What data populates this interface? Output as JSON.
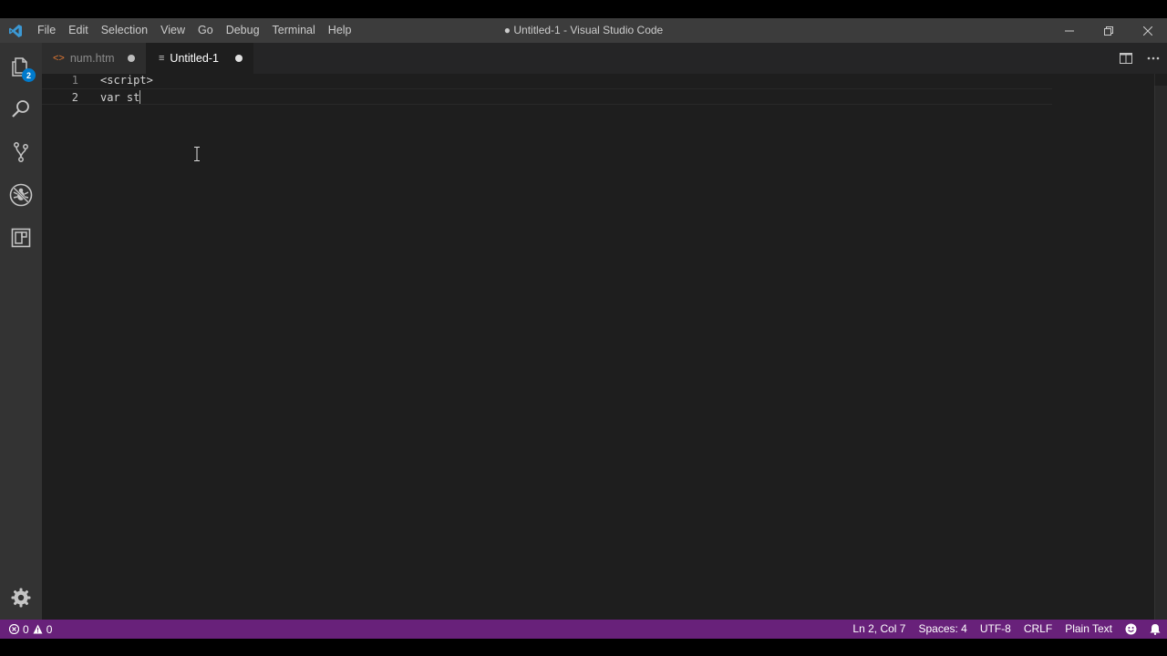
{
  "window": {
    "title": "● Untitled-1 - Visual Studio Code"
  },
  "menu": {
    "items": [
      "File",
      "Edit",
      "Selection",
      "View",
      "Go",
      "Debug",
      "Terminal",
      "Help"
    ]
  },
  "activity": {
    "explorer_badge": "2"
  },
  "tabs": [
    {
      "icon": "<>",
      "label": "num.htm",
      "dirty": true,
      "active": false
    },
    {
      "icon": "≡",
      "label": "Untitled-1",
      "dirty": true,
      "active": true
    }
  ],
  "editor": {
    "lines": [
      {
        "number": "1",
        "text": "<script>"
      },
      {
        "number": "2",
        "text": "var st"
      }
    ]
  },
  "statusbar": {
    "errors": "0",
    "warnings": "0",
    "position": "Ln 2, Col 7",
    "spaces": "Spaces: 4",
    "encoding": "UTF-8",
    "eol": "CRLF",
    "language": "Plain Text"
  },
  "colors": {
    "titlebar": "#3c3c3c",
    "activitybar": "#333333",
    "editor_bg": "#1e1e1e",
    "statusbar": "#68217a",
    "accent": "#007acc",
    "html_icon": "#e37933"
  }
}
